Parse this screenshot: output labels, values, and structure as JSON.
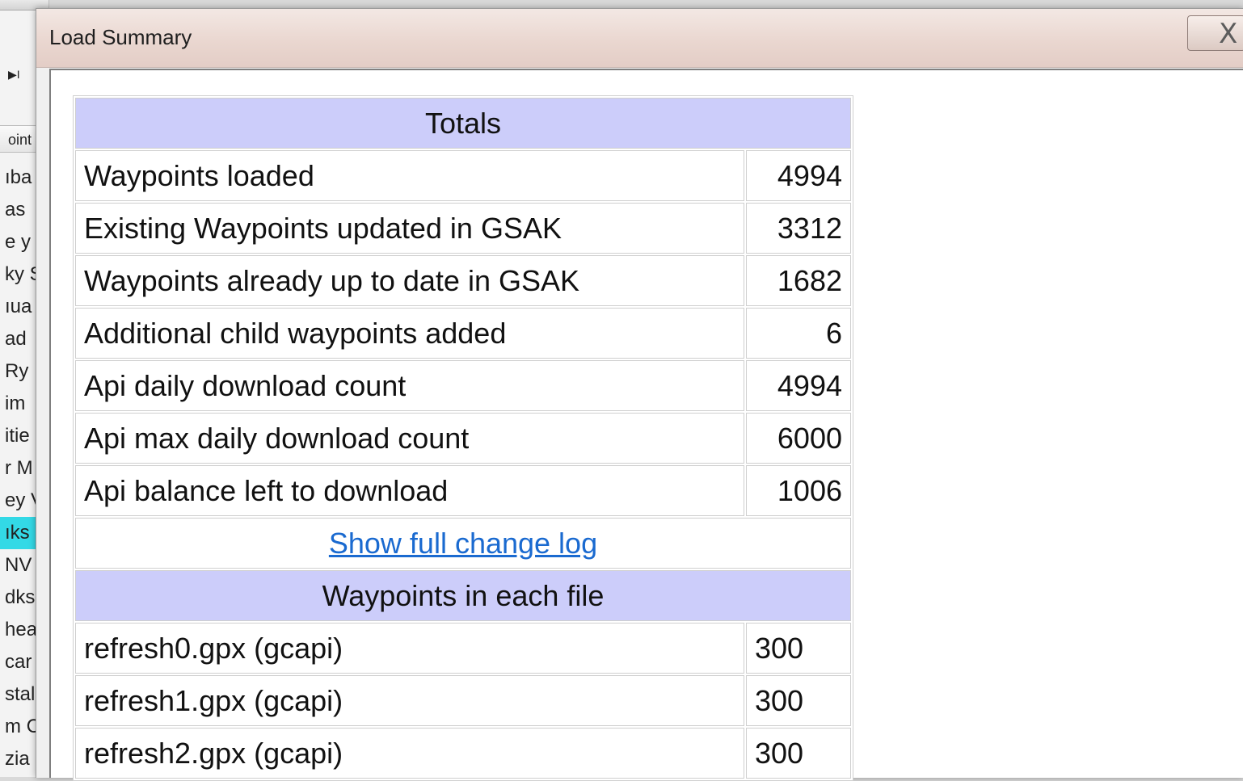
{
  "background": {
    "strip_button": "▶I",
    "column_header": "oint",
    "list_rows": [
      "ıba",
      "as",
      "e y",
      "ky S",
      "ıua",
      "ad",
      "Ry",
      "im",
      "itie",
      "r M",
      "ey V",
      "ıks",
      "NV",
      "dks",
      "hea",
      "car",
      "stal",
      "m C",
      "zia"
    ],
    "highlight_index": 11,
    "highlight_color": "#33d9e6"
  },
  "dialog": {
    "title": "Load Summary",
    "close_label": "X",
    "totals_header": "Totals",
    "totals": [
      {
        "label": "Waypoints loaded",
        "value": "4994"
      },
      {
        "label": "Existing Waypoints updated in GSAK",
        "value": "3312"
      },
      {
        "label": "Waypoints already up to date in GSAK",
        "value": "1682"
      },
      {
        "label": "Additional child waypoints added",
        "value": "6"
      },
      {
        "label": "Api daily download count",
        "value": "4994"
      },
      {
        "label": "Api max daily download count",
        "value": "6000"
      },
      {
        "label": "Api balance left to download",
        "value": "1006"
      }
    ],
    "change_log_link": "Show full change log",
    "files_header": "Waypoints in each file",
    "files": [
      {
        "name": "refresh0.gpx (gcapi)",
        "count": "300"
      },
      {
        "name": "refresh1.gpx (gcapi)",
        "count": "300"
      },
      {
        "name": "refresh2.gpx (gcapi)",
        "count": "300"
      }
    ],
    "colors": {
      "header_bg": "#cccdfa",
      "link": "#1a6ad0"
    }
  }
}
